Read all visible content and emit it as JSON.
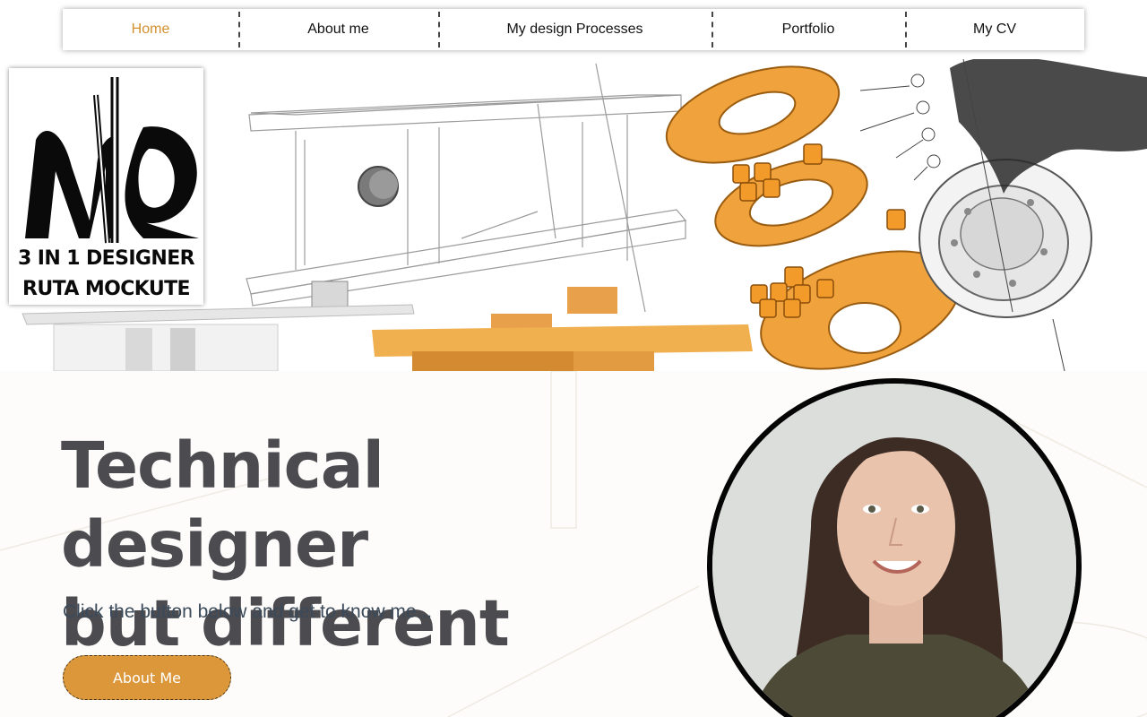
{
  "nav": {
    "items": [
      {
        "label": "Home",
        "active": true
      },
      {
        "label": "About me",
        "active": false
      },
      {
        "label": "My design Processes",
        "active": false
      },
      {
        "label": "Portfolio",
        "active": false
      },
      {
        "label": "My CV",
        "active": false
      }
    ]
  },
  "logo": {
    "line1": "3 IN 1 DESIGNER",
    "line2": "RUTA MOCKUTE"
  },
  "hero": {
    "headline_line1": "Technical designer",
    "headline_line2": "but different",
    "subline": "Click the button below and get to know me...",
    "cta_label": "About Me"
  },
  "colors": {
    "accent": "#d3902e",
    "button": "#dc973a",
    "headline": "#4b4b50",
    "subline": "#3b4a5a"
  },
  "icons": [
    "logo-monogram-icon",
    "profile-photo"
  ]
}
